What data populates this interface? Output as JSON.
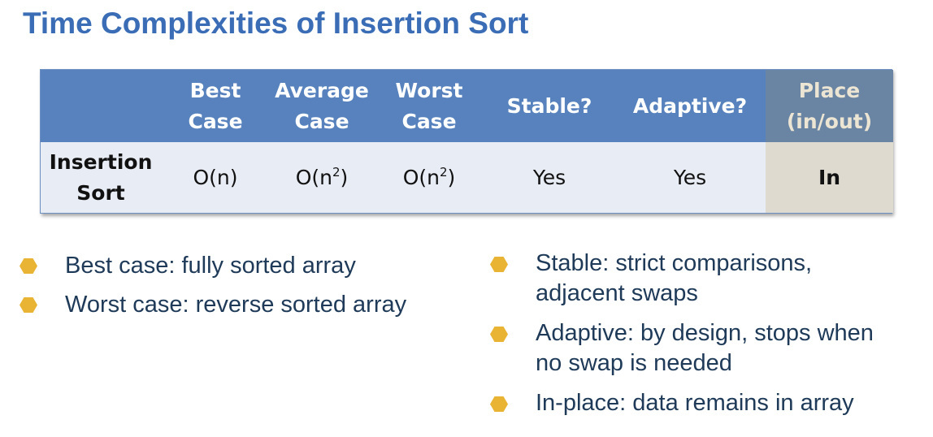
{
  "slide": {
    "title": "Time Complexities of Insertion Sort"
  },
  "table": {
    "headers": {
      "blank": "",
      "best": [
        "Best",
        "Case"
      ],
      "average": [
        "Average",
        "Case"
      ],
      "worst": [
        "Worst",
        "Case"
      ],
      "stable": "Stable?",
      "adaptive": "Adaptive?",
      "place": [
        "Place",
        "(in/out)"
      ]
    },
    "rows": [
      {
        "name": [
          "Insertion",
          "Sort"
        ],
        "best": "O(n)",
        "average": {
          "base": "O(n",
          "exp": "2",
          "close": ")"
        },
        "worst": {
          "base": "O(n",
          "exp": "2",
          "close": ")"
        },
        "stable": "Yes",
        "adaptive": "Yes",
        "place": "In"
      }
    ]
  },
  "bullets": {
    "left": [
      {
        "icon": "hexagon-bullet-icon",
        "text": "Best case: fully sorted array"
      },
      {
        "icon": "hexagon-bullet-icon",
        "text": "Worst case: reverse sorted array"
      }
    ],
    "right": [
      {
        "icon": "hexagon-bullet-icon",
        "line1": "Stable: strict comparisons,",
        "line2": "adjacent swaps"
      },
      {
        "icon": "hexagon-bullet-icon",
        "line1": "Adaptive: by design, stops when",
        "line2": "no swap is needed"
      },
      {
        "icon": "hexagon-bullet-icon",
        "line1": "In-place: data remains in array",
        "line2": ""
      }
    ]
  },
  "colors": {
    "title": "#3a6db5",
    "header_bg": "#5782bd",
    "place_header_bg": "#6a85a3",
    "place_header_text": "#ece5d3",
    "row_bg": "#e8ecf4",
    "place_cell_bg": "#dedad0",
    "bullet": "#e9b433",
    "bullet_text": "#1e3a58"
  }
}
